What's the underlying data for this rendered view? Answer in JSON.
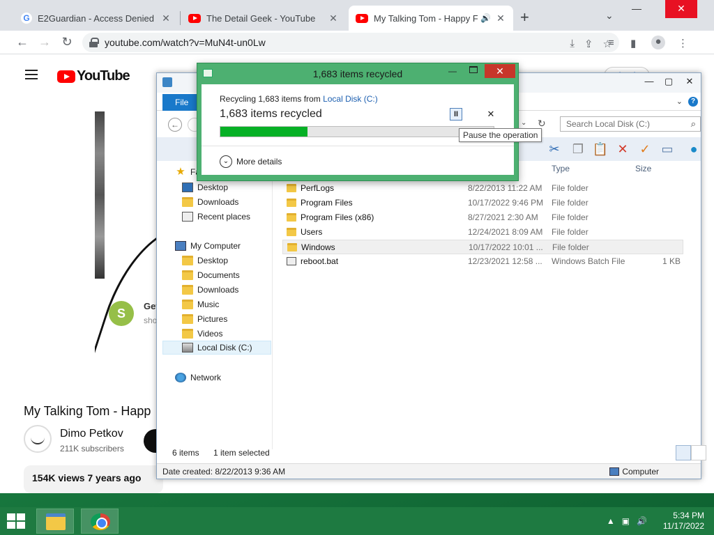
{
  "browser": {
    "tabs": [
      {
        "title": "E2Guardian - Access Denied",
        "favicon": "google-icon"
      },
      {
        "title": "The Detail Geek - YouTube",
        "favicon": "youtube-icon"
      },
      {
        "title": "My Talking Tom - Happy Face",
        "favicon": "youtube-icon",
        "active": true
      }
    ],
    "new_tab": "+",
    "url": "youtube.com/watch?v=MuN4t-un0Lw"
  },
  "youtube": {
    "logo_text": "YouTube",
    "sign_in": "Sign in",
    "ad_title": "Get",
    "ad_sub": "sho",
    "video_title": "My Talking Tom - Happ",
    "channel_name": "Dimo Petkov",
    "subscribers": "211K subscribers",
    "views": "154K views  7 years ago",
    "shop_letter": "S"
  },
  "explorer": {
    "ribbon_file": "File",
    "search_placeholder": "Search Local Disk (C:)",
    "nav": {
      "favorites_label": "Fa",
      "favorites": [
        "Desktop",
        "Downloads",
        "Recent places"
      ],
      "computer_label": "My Computer",
      "computer": [
        "Desktop",
        "Documents",
        "Downloads",
        "Music",
        "Pictures",
        "Videos",
        "Local Disk (C:)"
      ],
      "network_label": "Network"
    },
    "columns": {
      "type": "Type",
      "size": "Size"
    },
    "files": [
      {
        "name": "PerfLogs",
        "date": "8/22/2013 11:22 AM",
        "type": "File folder",
        "size": ""
      },
      {
        "name": "Program Files",
        "date": "10/17/2022 9:46 PM",
        "type": "File folder",
        "size": ""
      },
      {
        "name": "Program Files (x86)",
        "date": "8/27/2021 2:30 AM",
        "type": "File folder",
        "size": ""
      },
      {
        "name": "Users",
        "date": "12/24/2021 8:09 AM",
        "type": "File folder",
        "size": ""
      },
      {
        "name": "Windows",
        "date": "10/17/2022 10:01 ...",
        "type": "File folder",
        "size": "",
        "selected": true
      },
      {
        "name": "reboot.bat",
        "date": "12/23/2021 12:58 ...",
        "type": "Windows Batch File",
        "size": "1 KB"
      }
    ],
    "status_items": "6 items",
    "status_selected": "1 item selected",
    "date_created": "Date created: 8/22/2013 9:36 AM",
    "computer_label": "Computer"
  },
  "dialog": {
    "title": "1,683 items recycled",
    "line1_prefix": "Recycling 1,683 items from ",
    "line1_link": "Local Disk (C:)",
    "headline": "1,683 items recycled",
    "progress": 0.32,
    "pause_glyph": "II",
    "cancel_glyph": "✕",
    "more_details": "More details",
    "tooltip": "Pause the operation"
  },
  "taskbar": {
    "time": "5:34 PM",
    "date": "11/17/2022"
  },
  "colors": {
    "dialog_frame": "#4db071",
    "progress_fill": "#06b025",
    "taskbar": "#1e7a41",
    "close_red": "#c7362a",
    "link": "#1c5fb0"
  }
}
